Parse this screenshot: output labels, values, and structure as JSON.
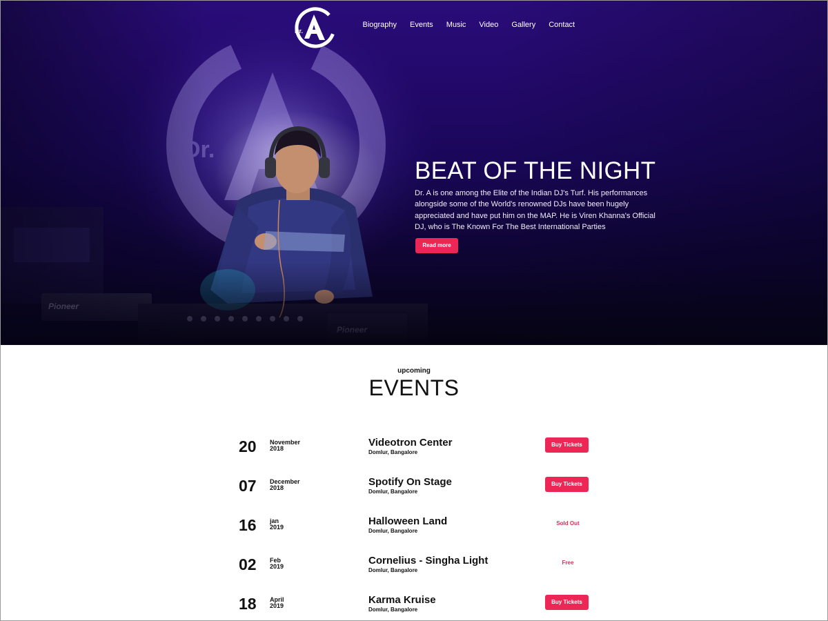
{
  "brand": {
    "logo_text": "Dr."
  },
  "nav": {
    "items": [
      "Biography",
      "Events",
      "Music",
      "Video",
      "Gallery",
      "Contact"
    ]
  },
  "hero": {
    "title": "BEAT OF THE NIGHT",
    "description": "Dr. A is one among the Elite of the Indian DJ's Turf. His performances alongside some of the World's renowned DJs have been hugely appreciated and have put him on the MAP. He is Viren Khanna's Official DJ, who is The Known For The Best International Parties",
    "cta_label": "Read more",
    "equipment_labels": [
      "Pioneer",
      "Pioneer"
    ]
  },
  "events": {
    "kicker": "upcoming",
    "title": "EVENTS",
    "items": [
      {
        "day": "20",
        "month": "November",
        "year": "2018",
        "name": "Videotron Center",
        "place": "Domlur, Bangalore",
        "action": "Buy Tickets",
        "action_type": "button"
      },
      {
        "day": "07",
        "month": "December",
        "year": "2018",
        "name": "Spotify On Stage",
        "place": "Domlur, Bangalore",
        "action": "Buy Tickets",
        "action_type": "button"
      },
      {
        "day": "16",
        "month": "jan",
        "year": "2019",
        "name": "Halloween Land",
        "place": "Domlur, Bangalore",
        "action": "Sold Out",
        "action_type": "status"
      },
      {
        "day": "02",
        "month": "Feb",
        "year": "2019",
        "name": "Cornelius - Singha Light",
        "place": "Domlur, Bangalore",
        "action": "Free",
        "action_type": "status"
      },
      {
        "day": "18",
        "month": "April",
        "year": "2019",
        "name": "Karma Kruise",
        "place": "Domlur, Bangalore",
        "action": "Buy Tickets",
        "action_type": "button"
      }
    ]
  },
  "colors": {
    "accent": "#ec2756",
    "hero_bg": "#22096a",
    "text": "#111111"
  }
}
